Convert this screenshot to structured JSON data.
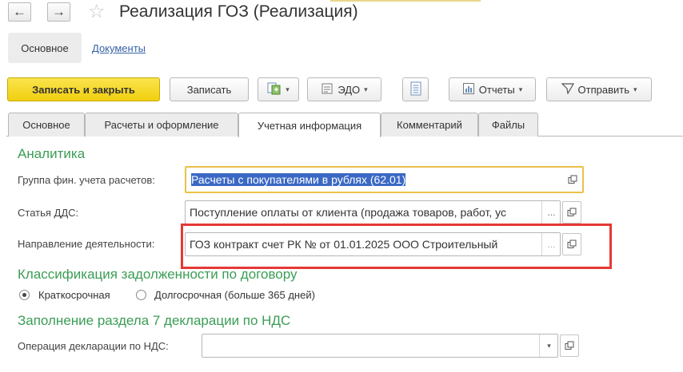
{
  "window": {
    "title": "Реализация ГОЗ (Реализация)"
  },
  "topnav": {
    "main": "Основное",
    "documents": "Документы"
  },
  "toolbar": {
    "save_close": "Записать и закрыть",
    "save": "Записать",
    "edo": "ЭДО",
    "reports": "Отчеты",
    "send": "Отправить"
  },
  "tabs": [
    "Основное",
    "Расчеты и оформление",
    "Учетная информация",
    "Комментарий",
    "Файлы"
  ],
  "active_tab": "Учетная информация",
  "analytics": {
    "heading": "Аналитика",
    "fin_group": {
      "label": "Группа фин. учета расчетов:",
      "value": "Расчеты с покупателями в рублях (62.01)"
    },
    "dds": {
      "label": "Статья ДДС:",
      "value": "Поступление оплаты от клиента (продажа товаров, работ, ус"
    },
    "direction": {
      "label": "Направление деятельности:",
      "value": "ГОЗ контракт счет РК  № от 01.01.2025 ООО Строительный"
    }
  },
  "debt": {
    "heading": "Классификация задолженности по договору",
    "short": "Краткосрочная",
    "long": "Долгосрочная (больше 365 дней)",
    "selected": "short"
  },
  "vat": {
    "heading": "Заполнение раздела 7 декларации по НДС",
    "operation": {
      "label": "Операция декларации по НДС:",
      "value": ""
    }
  },
  "buttons": {
    "ellipsis": "..."
  },
  "colors": {
    "primary": "#f5d722",
    "section": "#3b9d55",
    "highlight": "#e53935",
    "selection": "#3b68c4",
    "focus": "#e8c24a"
  }
}
